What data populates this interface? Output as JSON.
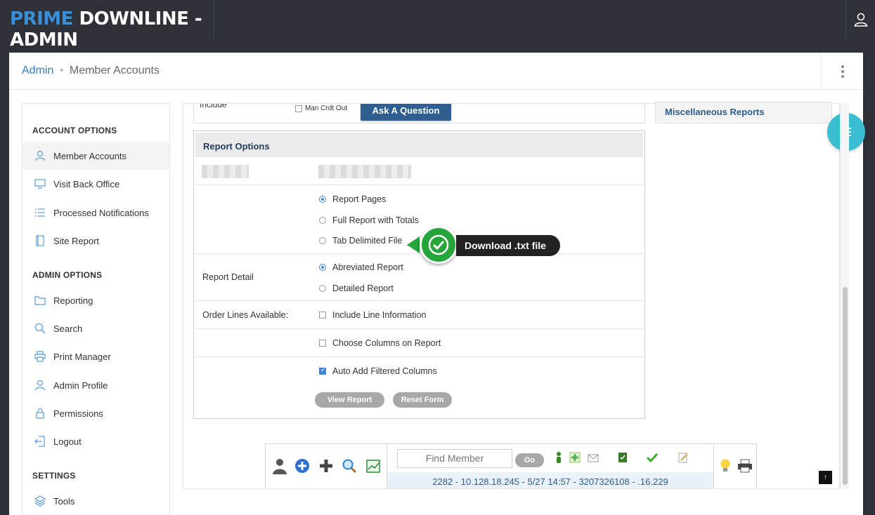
{
  "app": {
    "brand_part1": "PRIME",
    "brand_part2": "DOWNLINE - ADMIN"
  },
  "breadcrumb": {
    "root": "Admin",
    "separator": "•",
    "current": "Member Accounts"
  },
  "sidebar": {
    "sections": [
      {
        "title": "ACCOUNT OPTIONS"
      },
      {
        "title": "ADMIN OPTIONS"
      },
      {
        "title": "SETTINGS"
      }
    ],
    "items": [
      {
        "label": "Member Accounts",
        "icon": "user-icon"
      },
      {
        "label": "Visit Back Office",
        "icon": "monitor-icon"
      },
      {
        "label": "Processed Notifications",
        "icon": "list-icon"
      },
      {
        "label": "Site Report",
        "icon": "book-icon"
      },
      {
        "label": "Reporting",
        "icon": "folder-icon"
      },
      {
        "label": "Search",
        "icon": "search-icon"
      },
      {
        "label": "Print Manager",
        "icon": "printer-icon"
      },
      {
        "label": "Admin Profile",
        "icon": "user-icon"
      },
      {
        "label": "Permissions",
        "icon": "lock-icon"
      },
      {
        "label": "Logout",
        "icon": "logout-icon"
      },
      {
        "label": "Tools",
        "icon": "layers-icon"
      }
    ]
  },
  "include": {
    "label": "Include",
    "checkbox_label": "Man Crdt Out",
    "ask_button": "Ask A Question"
  },
  "report_options": {
    "title": "Report Options",
    "format_options": [
      {
        "label": "Report Pages",
        "selected": true
      },
      {
        "label": "Full Report with Totals",
        "selected": false
      },
      {
        "label": "Tab Delimited File",
        "selected": false
      }
    ],
    "detail_label": "Report Detail",
    "detail_options": [
      {
        "label": "Abreviated Report",
        "selected": true
      },
      {
        "label": "Detailed Report",
        "selected": false
      }
    ],
    "order_lines_label": "Order Lines Available:",
    "include_line_info": {
      "label": "Include Line Information",
      "checked": false
    },
    "choose_columns": {
      "label": "Choose Columns on Report",
      "checked": false
    },
    "auto_add_columns": {
      "label": "Auto Add Filtered Columns",
      "checked": true
    },
    "view_button": "View Report",
    "reset_button": "Reset Form"
  },
  "callout": {
    "text": "Download .txt file",
    "color": "#25a53a"
  },
  "right_panel": {
    "misc_reports": "Miscellaneous Reports"
  },
  "toolbar": {
    "find_placeholder": "Find Member",
    "go_button": "Go",
    "status": "2282 - 10.128.18.245 - 5/27 14:57 - 3207326108 - .16.229"
  },
  "colors": {
    "accent": "#337ab7",
    "brand_blue": "#3a8fd9",
    "fab": "#3bbdd3",
    "dark": "#2e3238"
  }
}
